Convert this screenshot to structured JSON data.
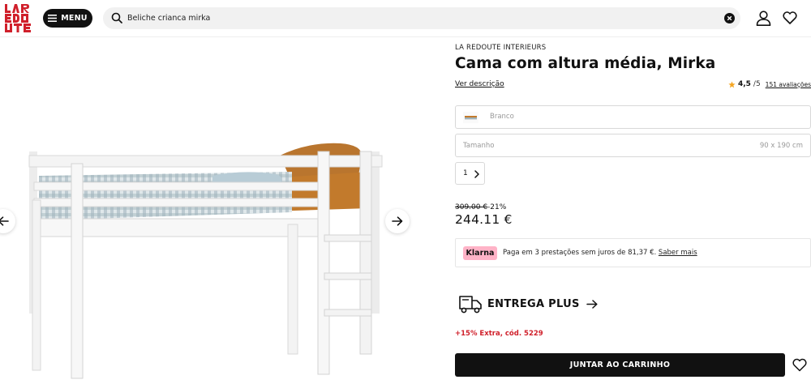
{
  "header": {
    "logo_alt": "LA REDOUTE",
    "menu_label": "MENU",
    "search": {
      "value": "Beliche crianca mirka",
      "placeholder": ""
    },
    "icons": {
      "search": "search-icon",
      "clear": "clear-icon",
      "account": "user-icon",
      "wishlist": "heart-icon"
    }
  },
  "product": {
    "brand": "LA REDOUTE INTERIEURS",
    "title": "Cama com altura média, Mirka",
    "description_link": "Ver descrição",
    "rating": {
      "score": "4,5",
      "out_of": "/5",
      "reviews": "151 avaliações"
    },
    "color": {
      "label": "Branco"
    },
    "size": {
      "label": "Tamanho",
      "value": "90 x 190 cm"
    },
    "quantity": "1",
    "price": {
      "old": "309.00 €",
      "discount": "-21%",
      "current": "244.11 €"
    },
    "klarna": {
      "badge": "Klarna",
      "text": "Paga em 3 prestações sem juros de 81,37 €. ",
      "link": "Saber mais"
    },
    "delivery": {
      "label": "ENTREGA PLUS"
    },
    "promo": "+15% Extra, cód. 5229",
    "cart_button": "JUNTAR AO CARRINHO"
  },
  "colors": {
    "accent": "#111111",
    "promo": "#d0202b",
    "klarna": "#ffb3c7",
    "star": "#f5a623"
  }
}
